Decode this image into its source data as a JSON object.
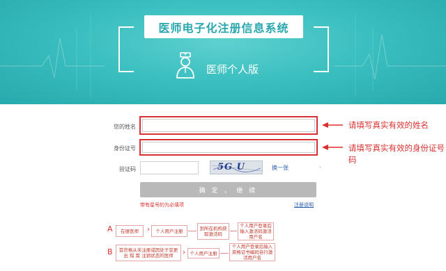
{
  "header": {
    "system_title": "医师电子化注册信息系统",
    "edition": "医师个人版",
    "doctor_icon": "doctor-icon"
  },
  "form": {
    "name_label": "您的姓名",
    "id_label": "身份证号",
    "captcha_label": "验证码",
    "name_value": "",
    "id_value": "",
    "captcha_value": "",
    "captcha_text": "5G U",
    "refresh_label": "换一张",
    "submit_label": "确 定 ， 继 续",
    "hint": "带有星号的为必填项",
    "help_link": "注册说明"
  },
  "annotations": {
    "name_note": "请填写真实有效的姓名",
    "id_note": "请填写真实有效的身份证号码"
  },
  "flow": {
    "row_a": {
      "label": "A",
      "steps": [
        "在册医师",
        "个人用户注册",
        "到所在机构获取激活码",
        "个人用户登录后输入激活码激活用户名"
      ]
    },
    "row_b": {
      "label": "B",
      "steps": [
        "首货格从未注册或因处于变更出 錯 需 注销状态的医师",
        "个人用户注册",
        "个人用户登录后输入资格证书编码自行激活用户名"
      ]
    }
  },
  "colors": {
    "header": "#3bbfc0",
    "accent_red": "#d9302f",
    "button_gray": "#b9b9b9"
  }
}
